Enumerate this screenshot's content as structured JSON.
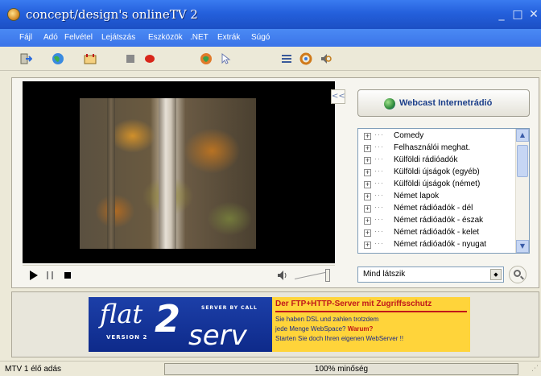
{
  "window": {
    "title": "concept/design's onlineTV 2"
  },
  "menu": {
    "items": [
      "Fájl",
      "Adó",
      "Felvétel",
      "Lejátszás",
      "Eszközök",
      ".NET",
      "Extrák",
      "Súgó"
    ]
  },
  "toolbar": {
    "icons": [
      "exit-icon",
      "globe-icon",
      "schedule-icon",
      "stop-record-icon",
      "record-icon",
      "web-icon",
      "cursor-icon",
      "settings-icon",
      "refresh-icon",
      "audio-icon"
    ]
  },
  "player": {
    "controls": [
      "play",
      "pause",
      "stop"
    ],
    "volume": 1.0
  },
  "sidebar": {
    "collapse_label": "<<",
    "webcast_label": "Webcast Internetrádió",
    "tree": [
      {
        "label": "Comedy"
      },
      {
        "label": "Felhasználói meghat."
      },
      {
        "label": "Külföldi rádióadók"
      },
      {
        "label": "Külföldi újságok (egyéb)"
      },
      {
        "label": "Külföldi újságok (német)"
      },
      {
        "label": "Német lapok"
      },
      {
        "label": "Német rádióadók - dél"
      },
      {
        "label": "Német rádióadók - észak"
      },
      {
        "label": "Német rádióadók - kelet"
      },
      {
        "label": "Német rádióadók - nyugat"
      }
    ],
    "filter": {
      "value": "Mind látszik"
    }
  },
  "banner": {
    "brand_flat": "flat",
    "brand_two": "2",
    "brand_serv": "serv",
    "version": "VERSION 2",
    "server_by_call": "SERVER BY CALL",
    "headline": "Der FTP+HTTP-Server mit Zugriffsschutz",
    "line2": "Sie haben DSL und zahlen trotzdem",
    "line3_prefix": "jede Menge WebSpace?",
    "line3_warum": "Warum?",
    "line4": "Starten Sie doch Ihren eigenen WebServer !!"
  },
  "status": {
    "text": "MTV 1 élő adás",
    "quality_label": "100% minőség",
    "quality_value": 1.0
  },
  "colors": {
    "titlebar": "#2460dc",
    "banner_blue": "#1c3fa8",
    "banner_yellow": "#ffd43a",
    "banner_red": "#c0161a"
  }
}
